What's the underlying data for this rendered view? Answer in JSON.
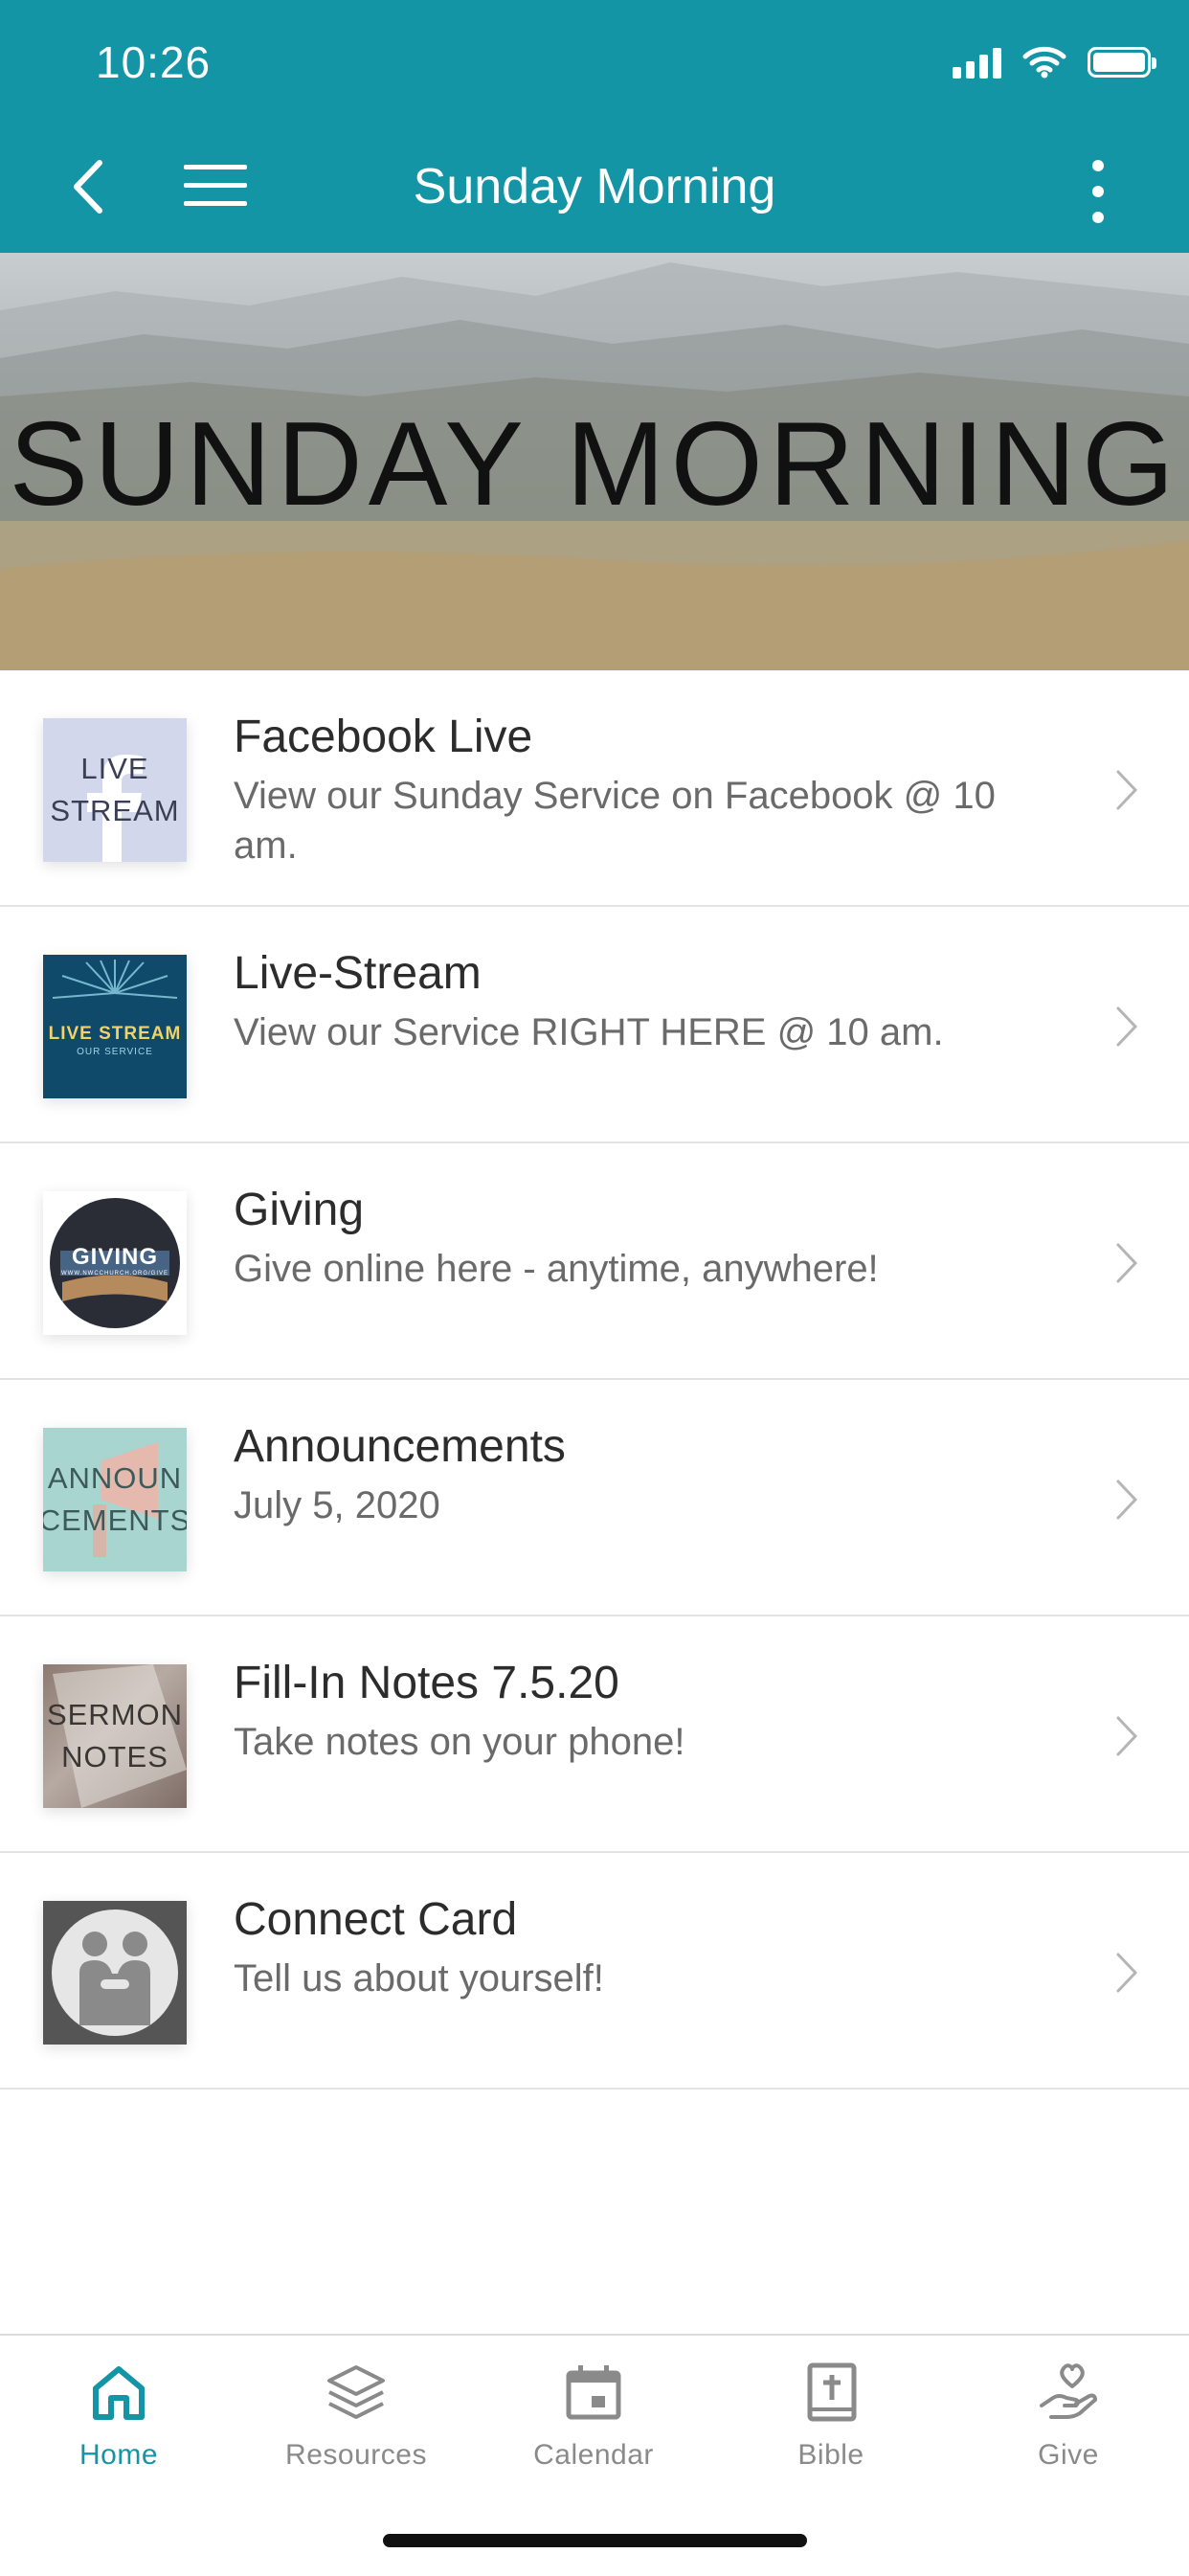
{
  "status": {
    "time": "10:26"
  },
  "nav": {
    "title": "Sunday Morning"
  },
  "hero": {
    "title": "SUNDAY MORNING"
  },
  "items": [
    {
      "title": "Facebook Live",
      "subtitle": "View our Sunday Service on Facebook @ 10 am.",
      "thumb_text": [
        "LIVE",
        "STREAM"
      ]
    },
    {
      "title": "Live-Stream",
      "subtitle": "View our Service RIGHT HERE @ 10 am.",
      "thumb_text": [
        "LIVE STREAM",
        "OUR SERVICE"
      ]
    },
    {
      "title": "Giving",
      "subtitle": "Give online here - anytime, anywhere!",
      "thumb_text": [
        "GIVING",
        "WWW.NWCCHURCH.ORG/GIVE"
      ]
    },
    {
      "title": "Announcements",
      "subtitle": "July 5, 2020",
      "thumb_text": [
        "ANNOUN",
        "CEMENTS"
      ]
    },
    {
      "title": "Fill-In Notes 7.5.20",
      "subtitle": "Take notes on your phone!",
      "thumb_text": [
        "SERMON",
        "NOTES"
      ]
    },
    {
      "title": "Connect Card",
      "subtitle": "Tell us about yourself!",
      "thumb_text": []
    }
  ],
  "tabs": [
    {
      "label": "Home",
      "icon": "home-icon",
      "active": true
    },
    {
      "label": "Resources",
      "icon": "layers-icon",
      "active": false
    },
    {
      "label": "Calendar",
      "icon": "calendar-icon",
      "active": false
    },
    {
      "label": "Bible",
      "icon": "bible-icon",
      "active": false
    },
    {
      "label": "Give",
      "icon": "give-icon",
      "active": false
    }
  ],
  "colors": {
    "primary": "#1495a6",
    "tab_inactive": "#8a8a8a"
  }
}
